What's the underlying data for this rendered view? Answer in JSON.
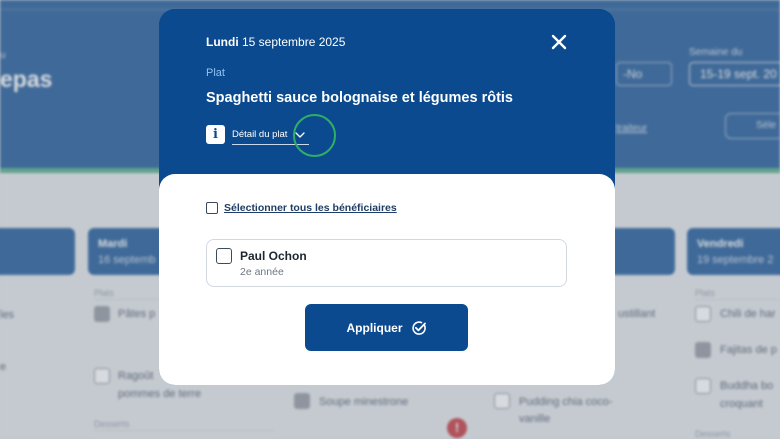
{
  "background": {
    "title": "epas",
    "select_value": "-No",
    "week_label": "Semaine du",
    "week_value": "15-19 sept. 20",
    "traiteur_link": "traiteur",
    "select_button": "Séle",
    "days": [
      {
        "name": "Mardi",
        "date": "16 septemb"
      },
      {
        "name": "Vendredi",
        "date": "19 septembre 2"
      }
    ],
    "items": {
      "col1_a": "les",
      "col1_b": "e",
      "plats_label_1": "Plats",
      "pates": "Pâtes p",
      "ragout_1": "Ragoût",
      "ragout_2": "pommes de terre",
      "desserts_label": "Desserts",
      "soupe": "Soupe minestrone",
      "pudding_1": "Pudding chia coco-",
      "pudding_2": "vanille",
      "ustillant": "ustillant",
      "plats_label_2": "Plats",
      "chili": "Chili de har",
      "fajitas": "Fajitas de p",
      "buddha_1": "Buddha bo",
      "buddha_2": "croquant",
      "desserts_label_2": "Desserts"
    }
  },
  "modal": {
    "day": "Lundi",
    "date": "15 septembre 2025",
    "category": "Plat",
    "dish": "Spaghetti sauce bolognaise et légumes rôtis",
    "detail_label": "Détail du plat",
    "select_all_label": "Sélectionner tous les bénéficiaires",
    "beneficiary": {
      "name": "Paul Ochon",
      "grade": "2e année"
    },
    "apply_label": "Appliquer"
  },
  "colors": {
    "primary": "#0b4a8f",
    "focus": "#2fae67",
    "accent_green": "#3fa57a"
  },
  "icons": [
    "close-icon",
    "info-icon",
    "chevron-down-icon",
    "check-circle-icon"
  ]
}
